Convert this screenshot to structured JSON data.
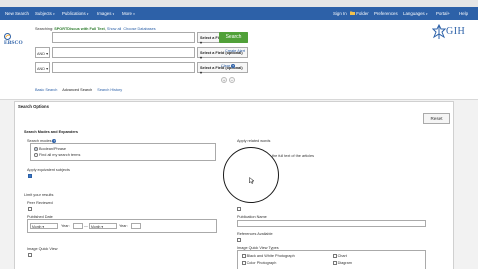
{
  "nav": {
    "left": [
      {
        "label": "New Search"
      },
      {
        "label": "Subjects",
        "caret": "▾"
      },
      {
        "label": "Publications",
        "caret": "▾"
      },
      {
        "label": "Images",
        "caret": "▾"
      },
      {
        "label": "More",
        "caret": "▾"
      }
    ],
    "right": [
      {
        "label": "Sign In"
      },
      {
        "label": "Folder"
      },
      {
        "label": "Preferences"
      },
      {
        "label": "Languages",
        "caret": "▾"
      },
      {
        "label": "Portal+"
      },
      {
        "label": "Help"
      }
    ]
  },
  "logo": {
    "text": "EBSCO"
  },
  "searching": {
    "prefix": "Searching:",
    "db": "SPORTDiscus with Full Text",
    "show_all": "Show all",
    "choose": "Choose Databases"
  },
  "rows": [
    {
      "bool": "",
      "field": "Select a Field (optional)"
    },
    {
      "bool": "AND",
      "field": "Select a Field (optional)"
    },
    {
      "bool": "AND",
      "field": "Select a Field (optional)"
    }
  ],
  "search_button": "Search",
  "create_alert": "Create Alert",
  "clear": "Clear",
  "add_row": "+",
  "remove_row": "−",
  "tabs": [
    "Basic Search",
    "Advanced Search",
    "Search History"
  ],
  "brand": {
    "name": "GIH"
  },
  "options": {
    "title": "Search Options",
    "reset": "Reset",
    "modes_title": "Search Modes and Expanders",
    "search_modes": "Search modes",
    "help_q": "?",
    "mode_options": [
      "Boolean/Phrase",
      "Find all my search terms"
    ],
    "apply_related": "Apply related words",
    "full_text": "the full text of the articles",
    "apply_subjects": "Apply equivalent subjects",
    "limit_title": "Limit your results",
    "peer_reviewed": "Peer Reviewed",
    "published_date": "Published Date",
    "month": "Month",
    "year": "Year:",
    "dash": "—",
    "publication_name": "Publication Name",
    "references": "References Available",
    "image_quick_view": "Image Quick View",
    "iqv_types": "Image Quick View Types",
    "types": [
      "Black and White Photograph",
      "Chart",
      "Color Photograph",
      "Diagram"
    ]
  },
  "colors": {
    "nav": "#2d61a8",
    "search_button": "#50a038",
    "link": "#2d61a8"
  }
}
